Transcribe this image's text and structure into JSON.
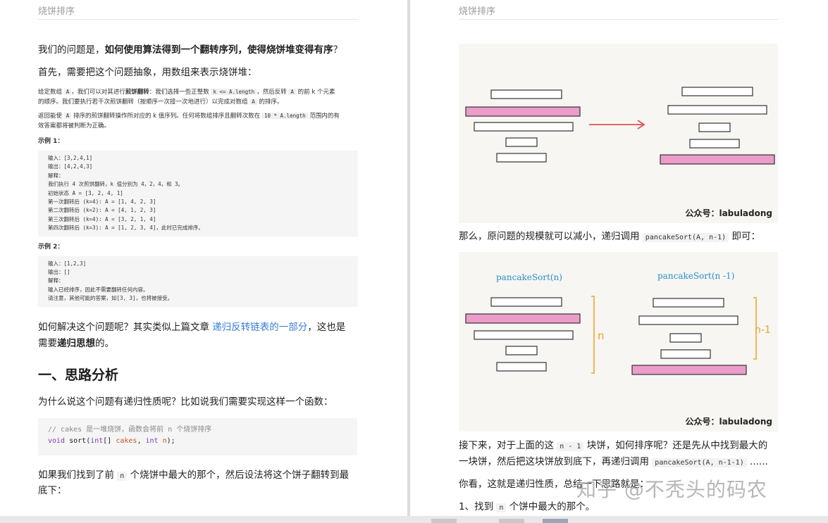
{
  "left": {
    "running_head": "烧饼排序",
    "p1_pre": "我们的问题是，",
    "p1_bold": "如何使用算法得到一个翻转序列，使得烧饼堆变得有序",
    "p1_post": "？",
    "p2": "首先，需要把这个问题抽象，用数组来表示烧饼堆：",
    "problem": {
      "l1a": "给定数组",
      "l1code1": "A",
      "l1b": "，我们可以对其进行",
      "l1bold": "煎饼翻转",
      "l1c": "：我们选择一些正整数",
      "l1code2": "k <= A.length",
      "l1d": "，然后反转",
      "l1code3": "A",
      "l1e": "的前 k 个元素",
      "l2a": "的顺序。我们要执行若干次煎饼翻转（按顺序一次接一次地进行）以完成对数组",
      "l2code": "A",
      "l2b": "的排序。",
      "l3a": "返回能使",
      "l3code1": "A",
      "l3b": "排序的煎饼翻转操作所对应的 k 值序列。任何将数组排序且翻转次数在",
      "l3code2": "10 * A.length",
      "l3c": "范围内的有",
      "l4": "效答案都将被判断为正确。",
      "ex1_title": "示例 1：",
      "ex1_lines": [
        "输入：[3,2,4,1]",
        "输出：[4,2,4,3]",
        "解释：",
        "我们执行 4 次煎饼翻转，k 值分别为 4，2，4，和 3。",
        "初始状态 A = [3, 2, 4, 1]",
        "第一次翻转后 (k=4): A = [1, 4, 2, 3]",
        "第二次翻转后 (k=2): A = [4, 1, 2, 3]",
        "第三次翻转后 (k=4): A = [3, 2, 1, 4]",
        "第四次翻转后 (k=3): A = [1, 2, 3, 4]，此时已完成排序。"
      ],
      "ex2_title": "示例 2：",
      "ex2_lines": [
        "输入：[1,2,3]",
        "输出：[]",
        "解释：",
        "输入已经排序，因此不需要翻转任何内容。",
        "请注意，其他可能的答案，如[3, 3]，也将被接受。"
      ]
    },
    "p3_pre": "如何解决这个问题呢？其实类似上篇文章",
    "p3_link": "递归反转链表的一部分",
    "p3_post": "，这也是",
    "p3_line2_pre": "需要",
    "p3_line2_bold": "递归思想",
    "p3_line2_post": "的。",
    "section_title": "一、思路分析",
    "p4": "为什么说这个问题有递归性质呢？比如说我们需要实现这样一个函数：",
    "code_comment": "// cakes 是一堆烧饼，函数会将前 n 个烧饼排序",
    "code_kw1": "void",
    "code_fn": " sort(",
    "code_kw2": "int",
    "code_arr": "[] ",
    "code_var1": "cakes",
    "code_comma": ", ",
    "code_kw3": "int",
    "code_sp": " ",
    "code_var2": "n",
    "code_end": ");",
    "p5_pre": "如果我们找到了前",
    "p5_code": "n",
    "p5_post": "个烧饼中最大的那个，然后设法将这个饼子翻转到最",
    "p5_line2": "底下："
  },
  "right": {
    "running_head": "烧饼排序",
    "fig1_caption": "公众号：labuladong",
    "p1_pre": "那么，原问题的规模就可以减小，递归调用",
    "p1_code": "pancakeSort(A, n-1)",
    "p1_post": "即可：",
    "fig2_label_left": "pancakeSort(n)",
    "fig2_label_right": "pancakeSort(n -1)",
    "fig2_brace_left": "n",
    "fig2_brace_right": "n-1",
    "fig2_caption": "公众号：labuladong",
    "p2_pre": "接下来，对于上面的这",
    "p2_code": "n - 1",
    "p2_post": "块饼，如何排序呢？还是先从中找到最大的",
    "p2_line2_pre": "一块饼，然后把这块饼放到底下，再递归调用",
    "p2_line2_code": "pancakeSort(A, n-1-1)",
    "p2_line2_post": "......",
    "p3": "你看，这就是递归性质，总结一下思路就是：",
    "p4_pre": "1、找到",
    "p4_code": "n",
    "p4_post": "个饼中最大的那个。",
    "watermark": "知乎 @不秃头的码农"
  },
  "colors": {
    "pink": "#ec9cc8",
    "arrow": "#e05252",
    "brace": "#f0a020",
    "label_blue": "#2a8fc8"
  }
}
